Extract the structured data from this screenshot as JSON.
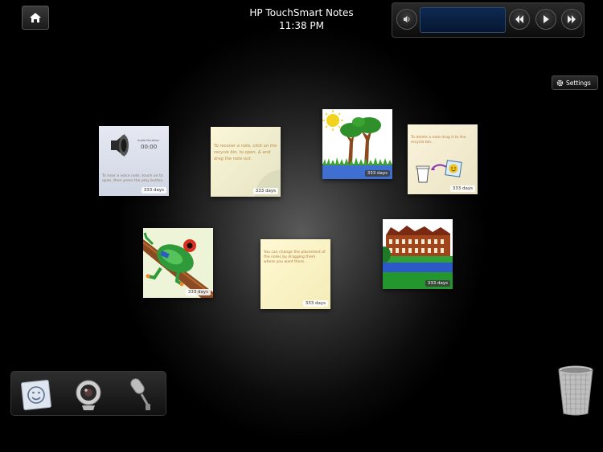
{
  "app": {
    "title": "HP TouchSmart Notes",
    "time": "11:38 PM"
  },
  "header": {
    "home_icon": "home-icon"
  },
  "player": {
    "volume_icon": "volume-icon",
    "rewind_icon": "rewind-icon",
    "play_icon": "play-icon",
    "forward_icon": "fast-forward-icon"
  },
  "settings": {
    "label": "Settings",
    "icon": "gear-icon"
  },
  "notes": [
    {
      "kind": "audio",
      "title": "Audio Duration",
      "duration": "00:00",
      "text": "To hear a voice note, touch on to open, then press the play button.",
      "days": "333 days"
    },
    {
      "kind": "handwritten",
      "text": "To recover a note, click on the recycle bin, to open, & and drag the note out.",
      "days": "333 days"
    },
    {
      "kind": "drawing-trees",
      "days": "333 days"
    },
    {
      "kind": "tip",
      "text": "To delete a note drag it to the recycle bin.",
      "days": "333 days"
    },
    {
      "kind": "photo-frog",
      "days": "333 days"
    },
    {
      "kind": "text",
      "text": "You can change the placement of the notes by dragging them where you want them.",
      "days": "333 days"
    },
    {
      "kind": "photo-building",
      "days": "333 days"
    }
  ],
  "tray": {
    "items": [
      "new-note-icon",
      "webcam-icon",
      "microphone-icon"
    ]
  },
  "trash": {
    "icon": "recycle-bin-icon"
  },
  "colors": {
    "background": "#000000",
    "accent_blue": "#0e2a52",
    "note_cream": "#fdf6cf"
  }
}
